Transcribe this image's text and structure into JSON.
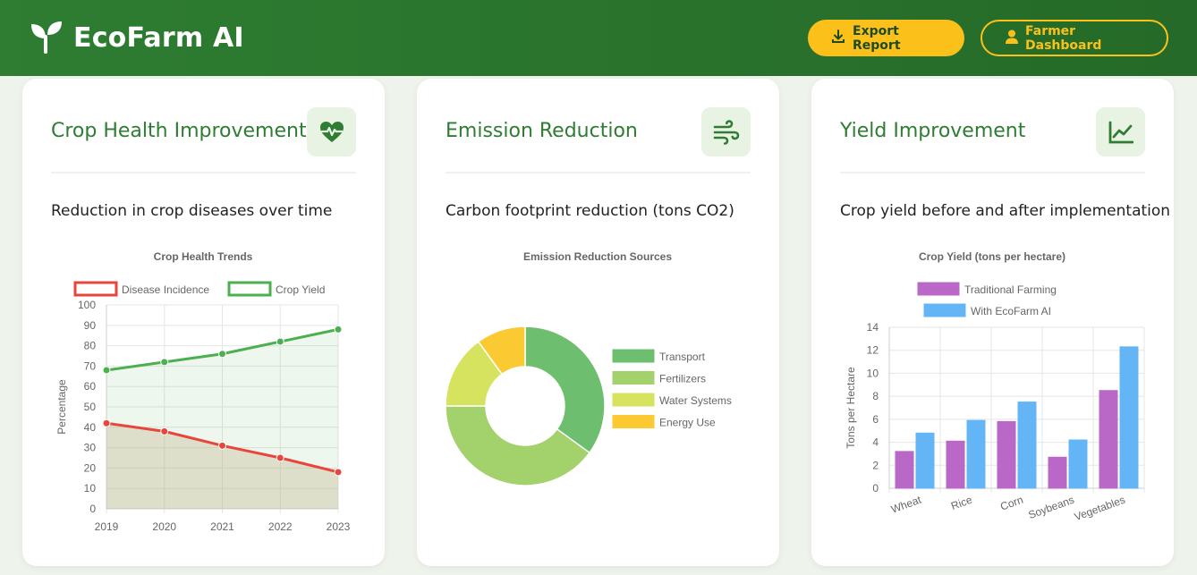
{
  "header": {
    "brand": "EcoFarm AI",
    "export_label": "Export Report",
    "dashboard_label": "Farmer Dashboard",
    "colors": {
      "primary": "#2e7d32",
      "accent": "#fbc11a"
    }
  },
  "cards": [
    {
      "title": "Crop Health Improvement",
      "icon": "heart-pulse-icon",
      "description": "Reduction in crop diseases over time"
    },
    {
      "title": "Emission Reduction",
      "icon": "wind-icon",
      "description": "Carbon footprint reduction (tons CO2)"
    },
    {
      "title": "Yield Improvement",
      "icon": "chart-line-icon",
      "description": "Crop yield before and after implementation"
    }
  ],
  "chart_data": [
    {
      "type": "line",
      "title": "Crop Health Trends",
      "ylabel": "Percentage",
      "x": [
        "2019",
        "2020",
        "2021",
        "2022",
        "2023"
      ],
      "ylim": [
        0,
        100
      ],
      "yticks": [
        0,
        10,
        20,
        30,
        40,
        50,
        60,
        70,
        80,
        90,
        100
      ],
      "legend": "top",
      "grid": true,
      "series": [
        {
          "name": "Disease Incidence",
          "values": [
            42,
            38,
            31,
            25,
            18
          ],
          "color": "#e8453c"
        },
        {
          "name": "Crop Yield",
          "values": [
            68,
            72,
            76,
            82,
            88
          ],
          "color": "#4caf50"
        }
      ]
    },
    {
      "type": "pie",
      "title": "Emission Reduction Sources",
      "legend": "right",
      "categories": [
        "Transport",
        "Fertilizers",
        "Water Systems",
        "Energy Use"
      ],
      "values": [
        35,
        40,
        15,
        10
      ],
      "colors": [
        "#6dbf6f",
        "#a3d16c",
        "#d6e35e",
        "#fbca33"
      ]
    },
    {
      "type": "bar",
      "title": "Crop Yield (tons per hectare)",
      "ylabel": "Tons per Hectare",
      "categories": [
        "Wheat",
        "Rice",
        "Corn",
        "Soybeans",
        "Vegetables"
      ],
      "ylim": [
        0,
        14
      ],
      "yticks": [
        0,
        2,
        4,
        6,
        8,
        10,
        12,
        14
      ],
      "legend": "top",
      "grid": true,
      "series": [
        {
          "name": "Traditional Farming",
          "values": [
            3.2,
            4.1,
            5.8,
            2.7,
            8.5
          ],
          "color": "#ba68c8"
        },
        {
          "name": "With EcoFarm AI",
          "values": [
            4.8,
            5.9,
            7.5,
            4.2,
            12.3
          ],
          "color": "#64b5f6"
        }
      ]
    }
  ]
}
